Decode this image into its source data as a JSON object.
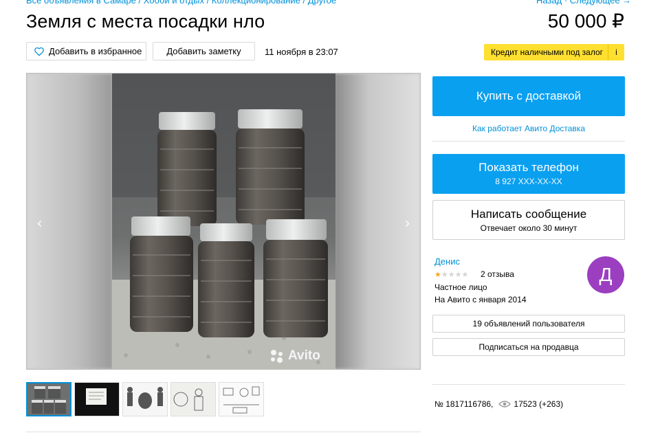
{
  "breadcrumb": "Все объявления в Самаре / Хобби и отдых / Коллекционирование / Другое",
  "nav": {
    "right": "Назад · Следующее →"
  },
  "listing": {
    "title": "Земля с места посадки нло",
    "price": "50 000 ₽",
    "date": "11 ноября в 23:07",
    "id_label": "№ 1817116786,",
    "views": "17523 (+263)"
  },
  "actions": {
    "favorite_label": "Добавить в избранное",
    "note_label": "Добавить заметку"
  },
  "credit": {
    "label": "Кредит наличными под залог",
    "info": "i"
  },
  "gallery": {
    "prev": "‹",
    "next": "›",
    "watermark": "Avito",
    "thumbnails": [
      "jars",
      "document",
      "figures",
      "diagram",
      "schematic"
    ]
  },
  "buy": {
    "button_label": "Купить с доставкой",
    "delivery_link": "Как работает Авито Доставка"
  },
  "phone": {
    "button_label": "Показать телефон",
    "number": "8 927 XXX-XX-XX"
  },
  "message": {
    "button_label": "Написать сообщение",
    "response_time": "Отвечает около 30 минут"
  },
  "seller": {
    "name": "Денис",
    "rating": 1,
    "rating_max": 5,
    "reviews": "2 отзыва",
    "type": "Частное лицо",
    "since": "На Авито с января 2014",
    "avatar_letter": "Д",
    "avatar_color": "#9b3fc0",
    "ads_button": "19 объявлений пользователя",
    "subscribe_button": "Подписаться на продавца"
  },
  "colors": {
    "accent": "#0aa0f0",
    "link": "#0091d9",
    "credit": "#ffdf30"
  }
}
